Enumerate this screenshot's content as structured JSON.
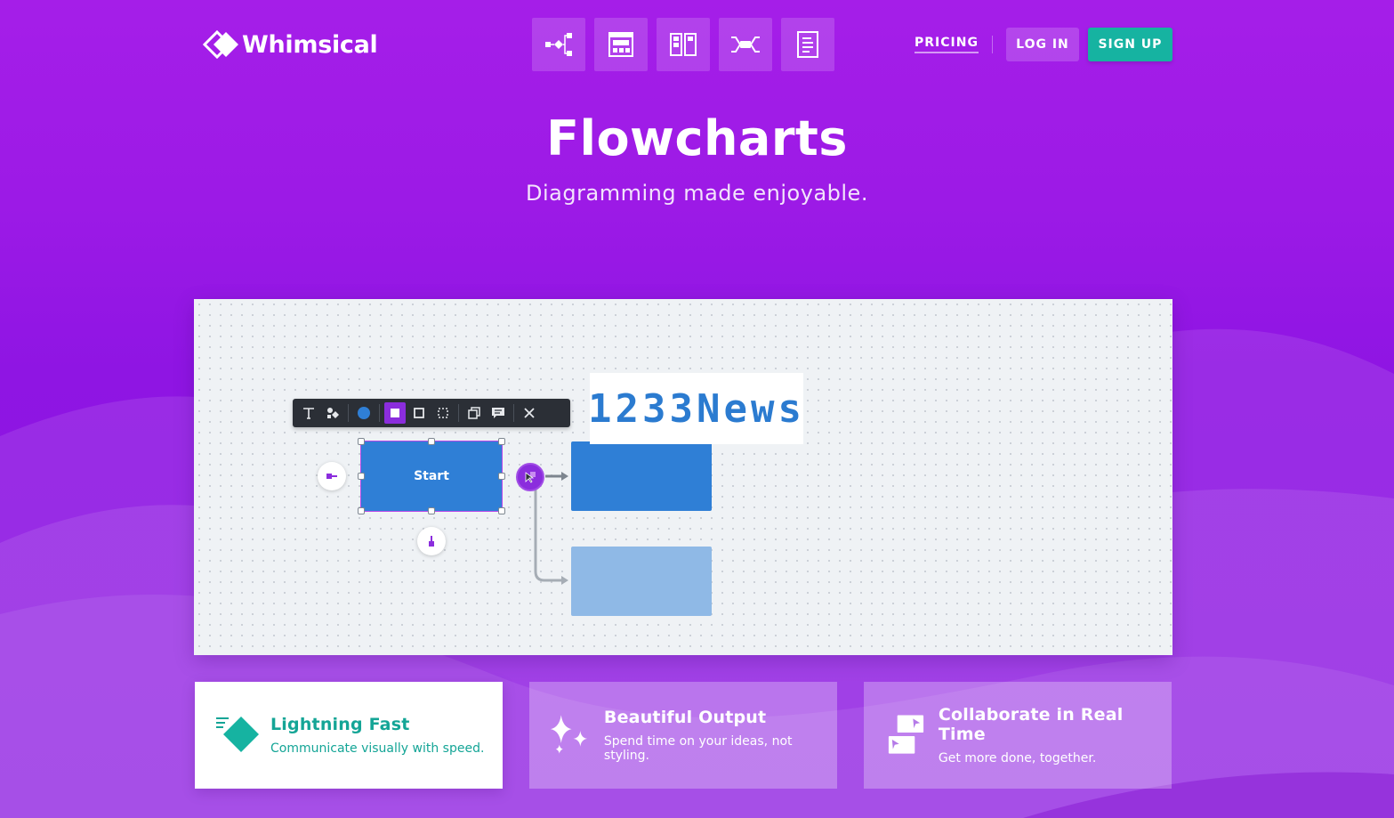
{
  "brand": {
    "name": "Whimsical"
  },
  "header": {
    "tool_tabs": [
      {
        "id": "flowcharts",
        "icon": "flowchart-icon"
      },
      {
        "id": "wireframes",
        "icon": "wireframe-icon"
      },
      {
        "id": "boards",
        "icon": "board-icon"
      },
      {
        "id": "mind-maps",
        "icon": "mindmap-icon"
      },
      {
        "id": "docs",
        "icon": "doc-icon"
      }
    ],
    "pricing_label": "PRICING",
    "login_label": "LOG IN",
    "signup_label": "SIGN UP"
  },
  "hero": {
    "title": "Flowcharts",
    "subtitle": "Diagramming made enjoyable."
  },
  "canvas": {
    "start_node_label": "Start",
    "overlay_text": "1233News",
    "toolbar_icons": [
      "text-icon",
      "shapes-icon",
      "color-icon",
      "fill-solid-icon",
      "fill-outline-icon",
      "fill-dashed-icon",
      "duplicate-icon",
      "comment-icon",
      "close-icon"
    ]
  },
  "features": [
    {
      "title": "Lightning Fast",
      "description": "Communicate visually with speed.",
      "icon": "lightning-diamond-icon"
    },
    {
      "title": "Beautiful Output",
      "description": "Spend time on your ideas, not styling.",
      "icon": "sparkle-icon"
    },
    {
      "title": "Collaborate in Real Time",
      "description": "Get more done, together.",
      "icon": "collaborate-icon"
    }
  ],
  "colors": {
    "brand_purple": "#a51ee8",
    "accent_teal": "#16b3a1",
    "node_blue": "#2f7fd6",
    "node_blue_light": "#8fb9e6"
  }
}
